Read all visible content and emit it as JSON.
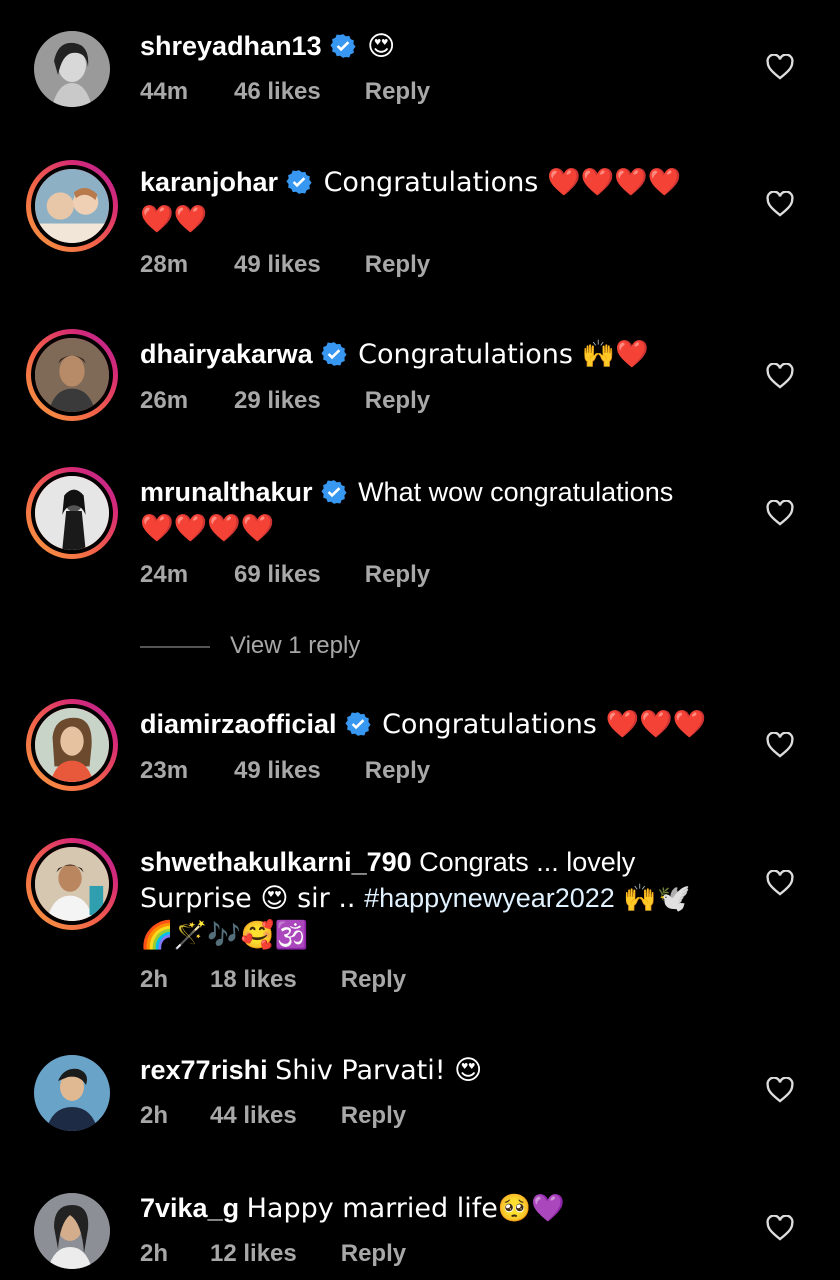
{
  "comments": [
    {
      "username": "shreyadhan13",
      "verified": true,
      "text": "😍",
      "time": "44m",
      "likes": "46 likes",
      "reply": "Reply"
    },
    {
      "username": "karanjohar",
      "verified": true,
      "text": "Congratulations ❤️❤️❤️❤️",
      "text2": "❤️❤️",
      "time": "28m",
      "likes": "49 likes",
      "reply": "Reply"
    },
    {
      "username": "dhairyakarwa",
      "verified": true,
      "text": "Congratulations 🙌❤️",
      "time": "26m",
      "likes": "29 likes",
      "reply": "Reply"
    },
    {
      "username": "mrunalthakur",
      "verified": true,
      "text": "What wow congratulations",
      "text2": "❤️❤️❤️❤️",
      "time": "24m",
      "likes": "69 likes",
      "reply": "Reply"
    },
    {
      "username": "diamirzaofficial",
      "verified": true,
      "text": "Congratulations ❤️❤️❤️",
      "time": "23m",
      "likes": "49 likes",
      "reply": "Reply"
    },
    {
      "username": "shwethakulkarni_790",
      "verified": false,
      "text": "Congrats ... lovely",
      "text2a": "Surprise 😍 sir .. ",
      "hashtag": "#happynewyear2022",
      "text2b": " 🙌🕊️",
      "text3": "🌈🪄🎶🥰🕉️",
      "time": "2h",
      "likes": "18 likes",
      "reply": "Reply"
    },
    {
      "username": "rex77rishi",
      "verified": false,
      "text": "Shiv Parvati! 😍",
      "time": "2h",
      "likes": "44 likes",
      "reply": "Reply"
    },
    {
      "username": "7vika_g",
      "verified": false,
      "text": "Happy married life🥺💜",
      "time": "2h",
      "likes": "12 likes",
      "reply": "Reply"
    }
  ],
  "view_replies": "View 1 reply",
  "colors": {
    "verified": "#3897f0",
    "meta": "#a8a8a8",
    "background": "#000000"
  }
}
